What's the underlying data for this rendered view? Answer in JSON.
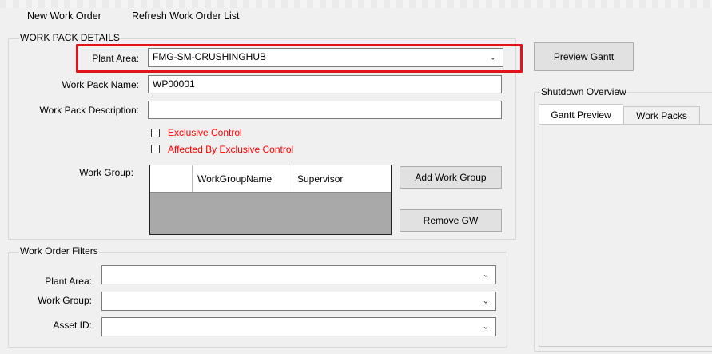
{
  "menu": {
    "new_work_order": "New Work Order",
    "refresh_list": "Refresh Work Order List"
  },
  "work_pack": {
    "title": "WORK PACK DETAILS",
    "plant_area_label": "Plant Area:",
    "plant_area_value": "FMG-SM-CRUSHINGHUB",
    "work_pack_name_label": "Work Pack Name:",
    "work_pack_name_value": "WP00001",
    "work_pack_description_label": "Work Pack Description:",
    "work_pack_description_value": "",
    "exclusive_control_label": "Exclusive Control",
    "affected_by_exclusive_label": "Affected By Exclusive Control",
    "work_group_label": "Work Group:",
    "grid_columns": [
      "WorkGroupName",
      "Supervisor"
    ],
    "add_work_group": "Add Work Group",
    "remove_gw": "Remove GW"
  },
  "filters": {
    "title": "Work Order Filters",
    "plant_area_label": "Plant Area:",
    "work_group_label": "Work Group:",
    "asset_id_label": "Asset ID:"
  },
  "right": {
    "preview_gantt": "Preview Gantt",
    "shutdown_title": "Shutdown Overview",
    "tabs": [
      "Gantt Preview",
      "Work Packs"
    ]
  },
  "colors": {
    "highlight": "#e2131c",
    "checkbox_label": "#ff0000",
    "grid_body": "#a9a9a9"
  }
}
